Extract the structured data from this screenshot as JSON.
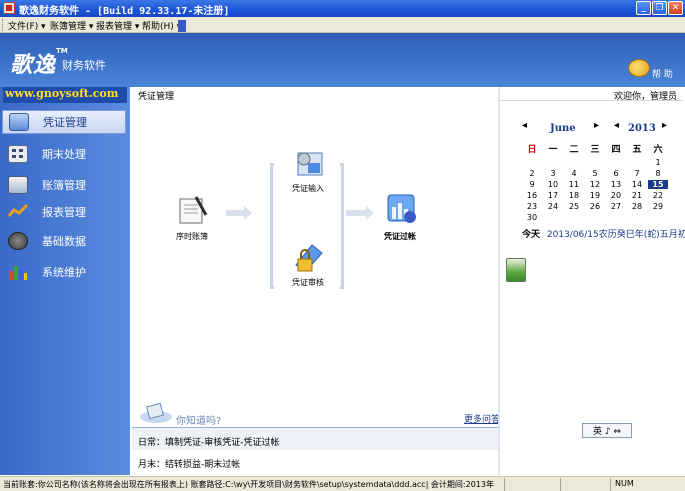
{
  "window": {
    "title": "歌逸财务软件 - [Build 92.33.17-未注册]",
    "minimize_symbol": "_",
    "restore_symbol": "❐",
    "close_symbol": "✕"
  },
  "menu": {
    "items": [
      {
        "label": "文件(F) ▾"
      },
      {
        "label": "账簿管理 ▾"
      },
      {
        "label": "报表管理 ▾"
      },
      {
        "label": "帮助(H) ▾"
      }
    ]
  },
  "banner": {
    "logo_text": "歌逸",
    "logo_tm": "TM",
    "logo_sub": "财务软件",
    "help_label": "帮 助"
  },
  "sidebar": {
    "url": "www.gnoysoft.com",
    "items": [
      {
        "label": "凭证管理",
        "icon": "voucher-icon",
        "active": true
      },
      {
        "label": "期末处理",
        "icon": "calculator-icon",
        "active": false
      },
      {
        "label": "账簿管理",
        "icon": "ledger-icon",
        "active": false
      },
      {
        "label": "报表管理",
        "icon": "chart-icon",
        "active": false
      },
      {
        "label": "基础数据",
        "icon": "dial-icon",
        "active": false
      },
      {
        "label": "系统维护",
        "icon": "bars-icon",
        "active": false
      }
    ]
  },
  "main": {
    "header": "凭证管理",
    "flow": {
      "start": "序时账簿",
      "input": "凭证输入",
      "audit": "凭证审核",
      "post": "凭证过帐"
    },
    "tips": {
      "title": "你知道吗?",
      "more": "更多问答",
      "daily": "日常：填制凭证-审核凭证-凭证过帐",
      "monthly": "月末：结转损益-期末过帐"
    }
  },
  "right": {
    "welcome": "欢迎你，管理员",
    "calendar": {
      "month": "June",
      "year": "2013",
      "weekdays": [
        "日",
        "一",
        "二",
        "三",
        "四",
        "五",
        "六"
      ],
      "weeks": [
        [
          "",
          "",
          "",
          "",
          "",
          "",
          "1"
        ],
        [
          "2",
          "3",
          "4",
          "5",
          "6",
          "7",
          "8"
        ],
        [
          "9",
          "10",
          "11",
          "12",
          "13",
          "14",
          "15"
        ],
        [
          "16",
          "17",
          "18",
          "19",
          "20",
          "21",
          "22"
        ],
        [
          "23",
          "24",
          "25",
          "26",
          "27",
          "28",
          "29"
        ],
        [
          "30",
          "",
          "",
          "",
          "",
          "",
          ""
        ]
      ],
      "today_day": "15",
      "today_label": "今天",
      "today_text": "2013/06/15农历癸巳年(蛇)五月初八"
    },
    "ime": "英 ♪ ⇔"
  },
  "status": {
    "path": "当前账套:你公司名称(该名称将会出现在所有报表上) 账套路径:C:\\wy\\开发项目\\财务软件\\setup\\systemdata\\ddd.acc| 会计期间:2013年",
    "num": "NUM"
  },
  "colors": {
    "accent": "#1a3a8a",
    "sidebar": "#3a6ac8",
    "today_red": "#cc0000"
  }
}
